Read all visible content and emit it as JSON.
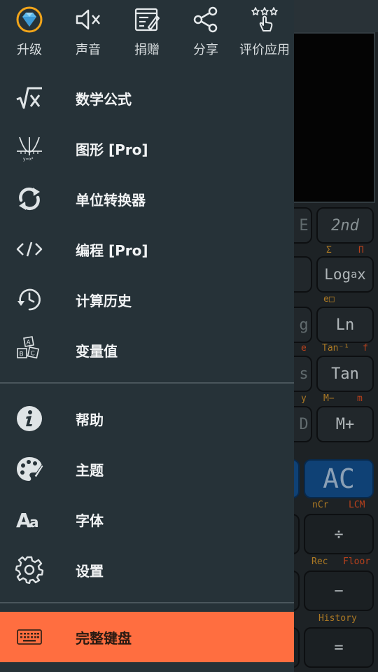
{
  "drawer": {
    "quick_actions": [
      {
        "label": "升级",
        "icon": "diamond-icon"
      },
      {
        "label": "声音",
        "icon": "volume-mute-icon"
      },
      {
        "label": "捐赠",
        "icon": "donate-note-icon"
      },
      {
        "label": "分享",
        "icon": "share-icon"
      },
      {
        "label": "评价应用",
        "icon": "rate-app-icon"
      }
    ],
    "menu": [
      {
        "label": "数学公式",
        "icon": "square-root-x-icon"
      },
      {
        "label": "图形 [Pro]",
        "icon": "graph-icon"
      },
      {
        "label": "单位转换器",
        "icon": "convert-arrows-icon"
      },
      {
        "label": "编程 [Pro]",
        "icon": "code-icon"
      },
      {
        "label": "计算历史",
        "icon": "history-clock-icon"
      },
      {
        "label": "变量值",
        "icon": "abc-blocks-icon"
      }
    ],
    "settings_menu": [
      {
        "label": "帮助",
        "icon": "info-icon"
      },
      {
        "label": "主题",
        "icon": "palette-icon"
      },
      {
        "label": "字体",
        "icon": "font-aa-icon"
      },
      {
        "label": "设置",
        "icon": "gear-icon"
      }
    ],
    "highlight_item": {
      "label": "完整键盘",
      "icon": "keyboard-icon"
    },
    "colors": {
      "drawer_bg": "#263238",
      "accent": "#ff6e40",
      "divider": "#4a565c"
    }
  },
  "calculator_background": {
    "keys": {
      "e_partial": "E",
      "second": "2nd",
      "loga": "Loga x",
      "g_partial": "g",
      "ln": "Ln",
      "s_partial": "s",
      "tan": "Tan",
      "d_partial": "D",
      "mplus": "M+",
      "ac": "AC",
      "divide": "÷",
      "minus": "−",
      "equals": "="
    },
    "labels": {
      "sigma": "Σ",
      "pi": "Π",
      "e_box": "e□",
      "e": "e",
      "tan_inv": "Tan⁻¹",
      "f": "f",
      "y": "y",
      "mminus": "M−",
      "m": "m",
      "ncr": "nCr",
      "lcm": "LCM",
      "rec": "Rec",
      "floor": "Floor",
      "history": "History"
    }
  }
}
